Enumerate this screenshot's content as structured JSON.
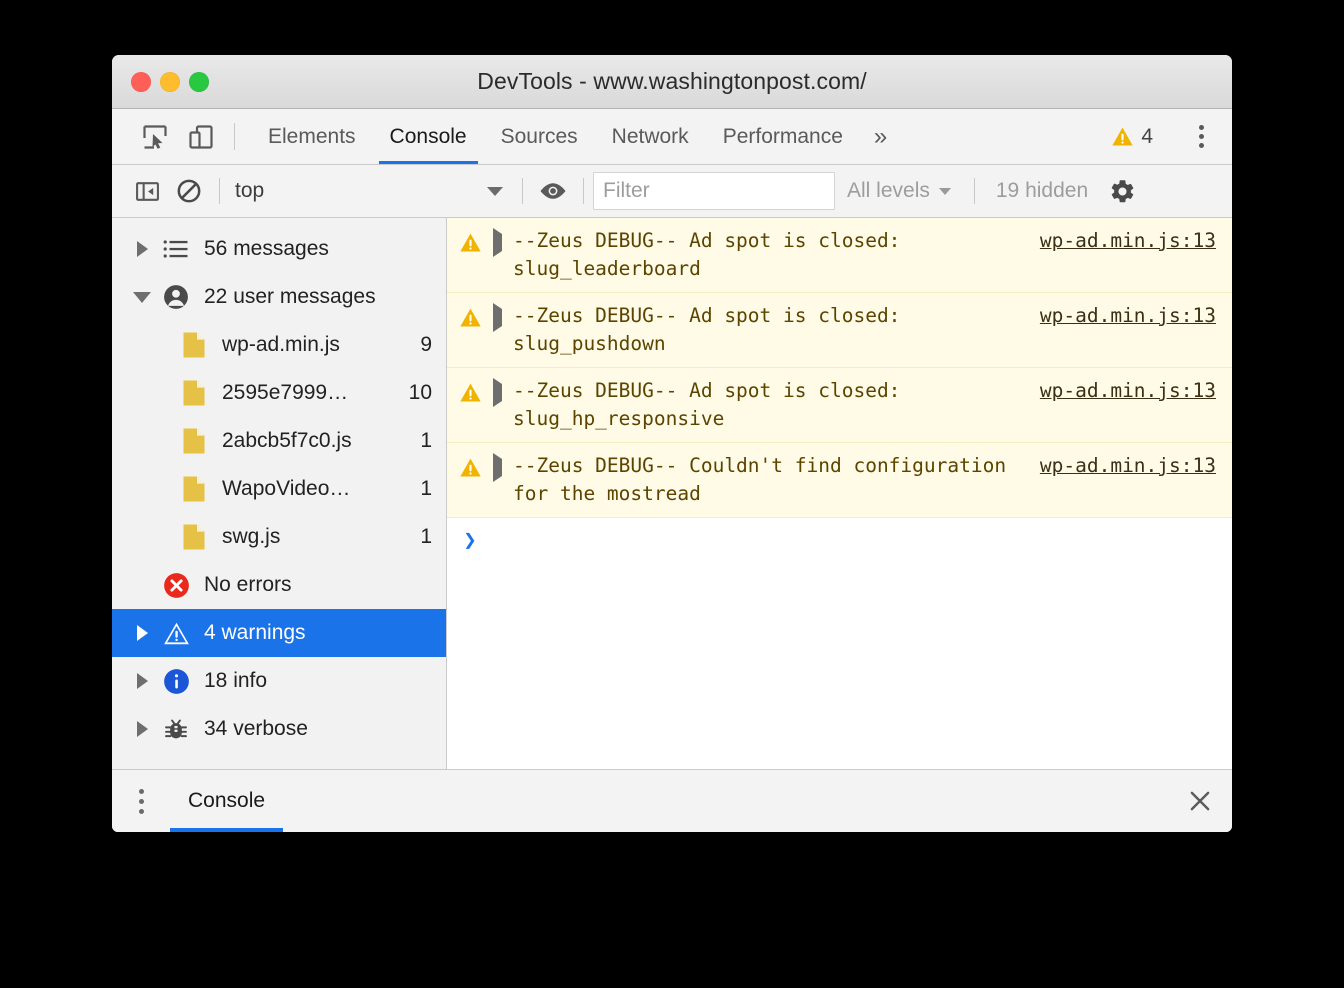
{
  "window": {
    "title": "DevTools - www.washingtonpost.com/",
    "traffic_lights": [
      {
        "name": "close-button",
        "color": "#ff5f57"
      },
      {
        "name": "minimize-button",
        "color": "#ffbd2e"
      },
      {
        "name": "maximize-button",
        "color": "#28c840"
      }
    ]
  },
  "tabbar": {
    "icons": [
      {
        "name": "inspect-element-icon",
        "label": "inspect-element-icon"
      },
      {
        "name": "device-toolbar-icon",
        "label": "device-toolbar-icon"
      }
    ],
    "tabs": [
      {
        "label": "Elements",
        "active": false
      },
      {
        "label": "Console",
        "active": true
      },
      {
        "label": "Sources",
        "active": false
      },
      {
        "label": "Network",
        "active": false
      },
      {
        "label": "Performance",
        "active": false
      }
    ],
    "more_label": "»",
    "warning_count": "4",
    "warning_color": "#f0b400",
    "kebab_label": "more-options"
  },
  "console_toolbar": {
    "sidebar_toggle": "sidebar-toggle-icon",
    "clear_console": "clear-console-icon",
    "context": {
      "value": "top",
      "caret": "▼"
    },
    "eye_icon": "live-expression-eye-icon",
    "filter": {
      "value": "",
      "placeholder": "Filter"
    },
    "levels": {
      "label": "All levels",
      "caret": "▼"
    },
    "hidden_label": "19 hidden",
    "settings_icon": "settings-gear-icon"
  },
  "sidebar": {
    "items": [
      {
        "name": "all-messages",
        "label": "56 messages",
        "icon": "list-icon",
        "disclosure": "collapsed",
        "count": "",
        "child": false,
        "selected": false
      },
      {
        "name": "user-messages",
        "label": "22 user messages",
        "icon": "user-icon",
        "disclosure": "expanded",
        "count": "",
        "child": false,
        "selected": false
      },
      {
        "name": "file-wp-ad-min-js",
        "label": "wp-ad.min.js",
        "icon": "js-file-icon",
        "disclosure": "none",
        "count": "9",
        "child": true,
        "selected": false
      },
      {
        "name": "file-2595e7999",
        "label": "2595e7999…",
        "icon": "js-file-icon",
        "disclosure": "none",
        "count": "10",
        "child": true,
        "selected": false
      },
      {
        "name": "file-2abcb5f7c0-js",
        "label": "2abcb5f7c0.js",
        "icon": "js-file-icon",
        "disclosure": "none",
        "count": "1",
        "child": true,
        "selected": false
      },
      {
        "name": "file-wapovideo",
        "label": "WapoVideo…",
        "icon": "js-file-icon",
        "disclosure": "none",
        "count": "1",
        "child": true,
        "selected": false
      },
      {
        "name": "file-swg-js",
        "label": "swg.js",
        "icon": "js-file-icon",
        "disclosure": "none",
        "count": "1",
        "child": true,
        "selected": false
      },
      {
        "name": "no-errors",
        "label": "No errors",
        "icon": "error-icon",
        "disclosure": "none",
        "count": "",
        "child": false,
        "selected": false
      },
      {
        "name": "warnings",
        "label": "4 warnings",
        "icon": "warning-icon",
        "disclosure": "collapsed",
        "count": "",
        "child": false,
        "selected": true
      },
      {
        "name": "info",
        "label": "18 info",
        "icon": "info-icon",
        "disclosure": "collapsed",
        "count": "",
        "child": false,
        "selected": false
      },
      {
        "name": "verbose",
        "label": "34 verbose",
        "icon": "bug-icon",
        "disclosure": "collapsed",
        "count": "",
        "child": false,
        "selected": false
      }
    ],
    "selected_bg": "#1a73e8"
  },
  "console": {
    "messages": [
      {
        "level": "warning",
        "text": "--Zeus DEBUG-- Ad spot is closed: slug_leaderboard",
        "source": "wp-ad.min.js:13"
      },
      {
        "level": "warning",
        "text": "--Zeus DEBUG-- Ad spot is closed: slug_pushdown",
        "source": "wp-ad.min.js:13"
      },
      {
        "level": "warning",
        "text": "--Zeus DEBUG-- Ad spot is closed: slug_hp_responsive",
        "source": "wp-ad.min.js:13"
      },
      {
        "level": "warning",
        "text": "--Zeus DEBUG-- Couldn't find configuration for the mostread",
        "source": "wp-ad.min.js:13"
      }
    ],
    "prompt_symbol": "❯",
    "warning_bg": "#fffbe6",
    "warning_text_color": "#5c4400"
  },
  "drawer": {
    "kebab_label": "drawer-more-options",
    "tabs": [
      {
        "label": "Console",
        "active": true
      }
    ],
    "close_label": "✕"
  }
}
